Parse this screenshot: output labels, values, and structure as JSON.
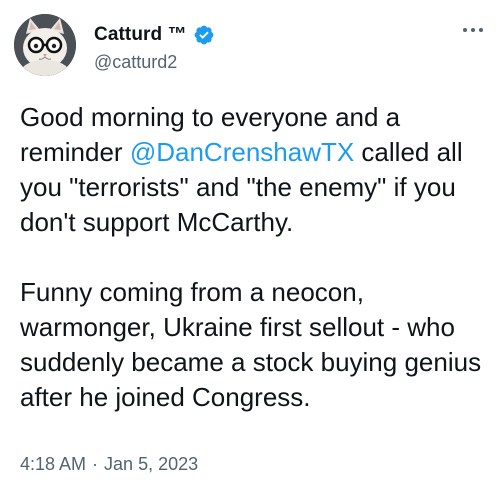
{
  "author": {
    "display_name": "Catturd ™",
    "handle": "@catturd2",
    "verified": true,
    "avatar_icon": "cat-with-glasses-avatar-icon"
  },
  "menu": {
    "more_icon": "more-dots-icon"
  },
  "tweet": {
    "paragraph1": {
      "before_mention": "Good morning to everyone and a reminder ",
      "mention": "@DanCrenshawTX",
      "after_mention": " called all you \"terrorists\" and \"the enemy\" if you don't support McCarthy."
    },
    "paragraph2": "Funny coming from a neocon, warmonger, Ukraine first sellout - who suddenly became a stock buying genius after he joined Congress."
  },
  "meta": {
    "time": "4:18 AM",
    "separator": "·",
    "date": "Jan 5, 2023"
  },
  "colors": {
    "text": "#0f1419",
    "secondary": "#536471",
    "link": "#1d9bf0",
    "verified": "#1d9bf0"
  }
}
